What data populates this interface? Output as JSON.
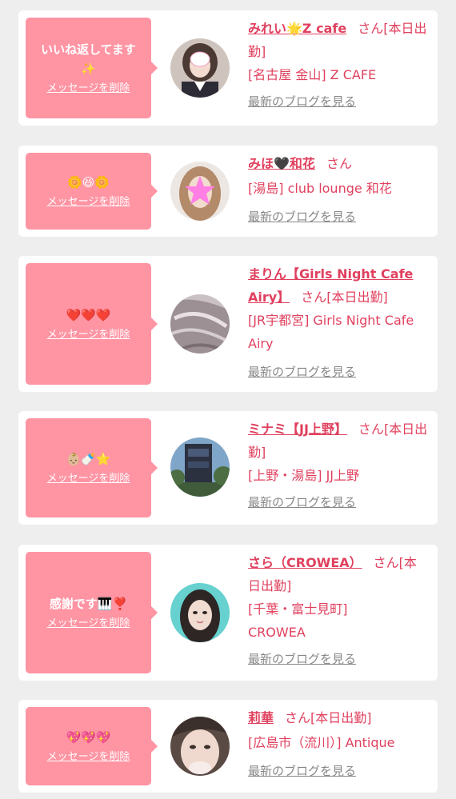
{
  "entries": [
    {
      "message": "いいね返してます\n✨",
      "delete_label": "メッセージを削除",
      "name": "みれい🌟Z cafe",
      "honorific": "さん",
      "status": "[本日出勤]",
      "location": "[名古屋 金山] Z CAFE",
      "blog_link": "最新のブログを見る",
      "avatar_icon": "avatar-photo"
    },
    {
      "message": "🌼😆🌼",
      "delete_label": "メッセージを削除",
      "name": "みほ🖤和花",
      "honorific": "さん",
      "status": "",
      "location": "[湯島] club lounge 和花",
      "blog_link": "最新のブログを見る",
      "avatar_icon": "avatar-photo"
    },
    {
      "message": "❤️❤️❤️",
      "delete_label": "メッセージを削除",
      "name": "まりん【Girls Night Cafe Airy】",
      "honorific": "さん",
      "status": "[本日出勤]",
      "location": "[JR宇都宮] Girls Night Cafe Airy",
      "blog_link": "最新のブログを見る",
      "avatar_icon": "avatar-photo"
    },
    {
      "message": "👶🏼🍼⭐",
      "delete_label": "メッセージを削除",
      "name": "ミナミ【JJ上野】",
      "honorific": "さん",
      "status": "[本日出勤]",
      "location": "[上野・湯島] JJ上野",
      "blog_link": "最新のブログを見る",
      "avatar_icon": "avatar-photo"
    },
    {
      "message": "感謝です🎹❣️",
      "delete_label": "メッセージを削除",
      "name": "さら（CROWEA）",
      "honorific": "さん",
      "status": "[本日出勤]",
      "location": "[千葉・富士見町] CROWEA",
      "blog_link": "最新のブログを見る",
      "avatar_icon": "avatar-photo"
    },
    {
      "message": "💖💖💖",
      "delete_label": "メッセージを削除",
      "name": "莉華",
      "honorific": "さん",
      "status": "[本日出勤]",
      "location": "[広島市（流川）] Antique",
      "blog_link": "最新のブログを見る",
      "avatar_icon": "avatar-photo"
    }
  ],
  "colors": {
    "page_bg": "#eeeeee",
    "card_bg": "#ffffff",
    "bubble": "#ff94a3",
    "accent": "#e0405e",
    "link_gray": "#888888"
  }
}
